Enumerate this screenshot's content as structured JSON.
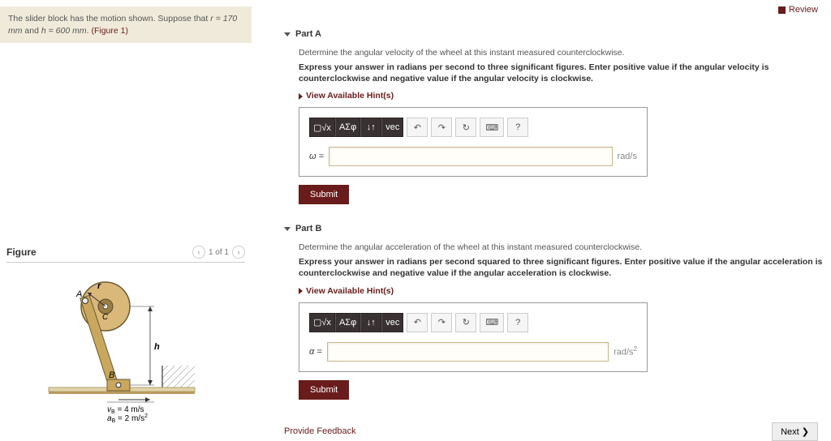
{
  "review": {
    "label": "Review"
  },
  "problem": {
    "text_a": "The slider block has the motion shown. Suppose that ",
    "r_eq": "r = 170 mm",
    "text_b": " and ",
    "h_eq": "h = 600 mm",
    "text_c": ". ",
    "fig_ref": "(Figure 1)"
  },
  "partA": {
    "title": "Part A",
    "prompt1": "Determine the angular velocity of the wheel at this instant measured counterclockwise.",
    "prompt2": "Express your answer in radians per second to three significant figures. Enter positive value if the angular velocity is counterclockwise and negative value if the angular velocity is clockwise.",
    "hints": "View Available Hint(s)",
    "var": "ω =",
    "unit": "rad/s",
    "value": "",
    "submit": "Submit"
  },
  "partB": {
    "title": "Part B",
    "prompt1": "Determine the angular acceleration of the wheel at this instant measured counterclockwise.",
    "prompt2": "Express your answer in radians per second squared to three significant figures. Enter positive value if the angular acceleration is counterclockwise and negative value if the angular acceleration is clockwise.",
    "hints": "View Available Hint(s)",
    "var": "α =",
    "unit_pre": "rad/s",
    "unit_sup": "2",
    "value": "",
    "submit": "Submit"
  },
  "toolbar": {
    "templates": "▢√x",
    "greek": "ΑΣφ",
    "sub": "↓↑",
    "vec": "vec",
    "undo": "↶",
    "redo": "↷",
    "reset": "↻",
    "keyboard": "⌨",
    "help": "?"
  },
  "figure": {
    "title": "Figure",
    "pager": "1 of 1",
    "labels": {
      "A": "A",
      "C": "C",
      "B": "B",
      "r": "r",
      "h": "h"
    },
    "eq1_lhs": "v",
    "eq1_sub": "B",
    "eq1_rhs": " = 4 m/s",
    "eq2_lhs": "a",
    "eq2_sub": "B",
    "eq2_rhs": " = 2 m/s",
    "eq2_sup": "2"
  },
  "footer": {
    "feedback": "Provide Feedback",
    "next": "Next ❯"
  }
}
